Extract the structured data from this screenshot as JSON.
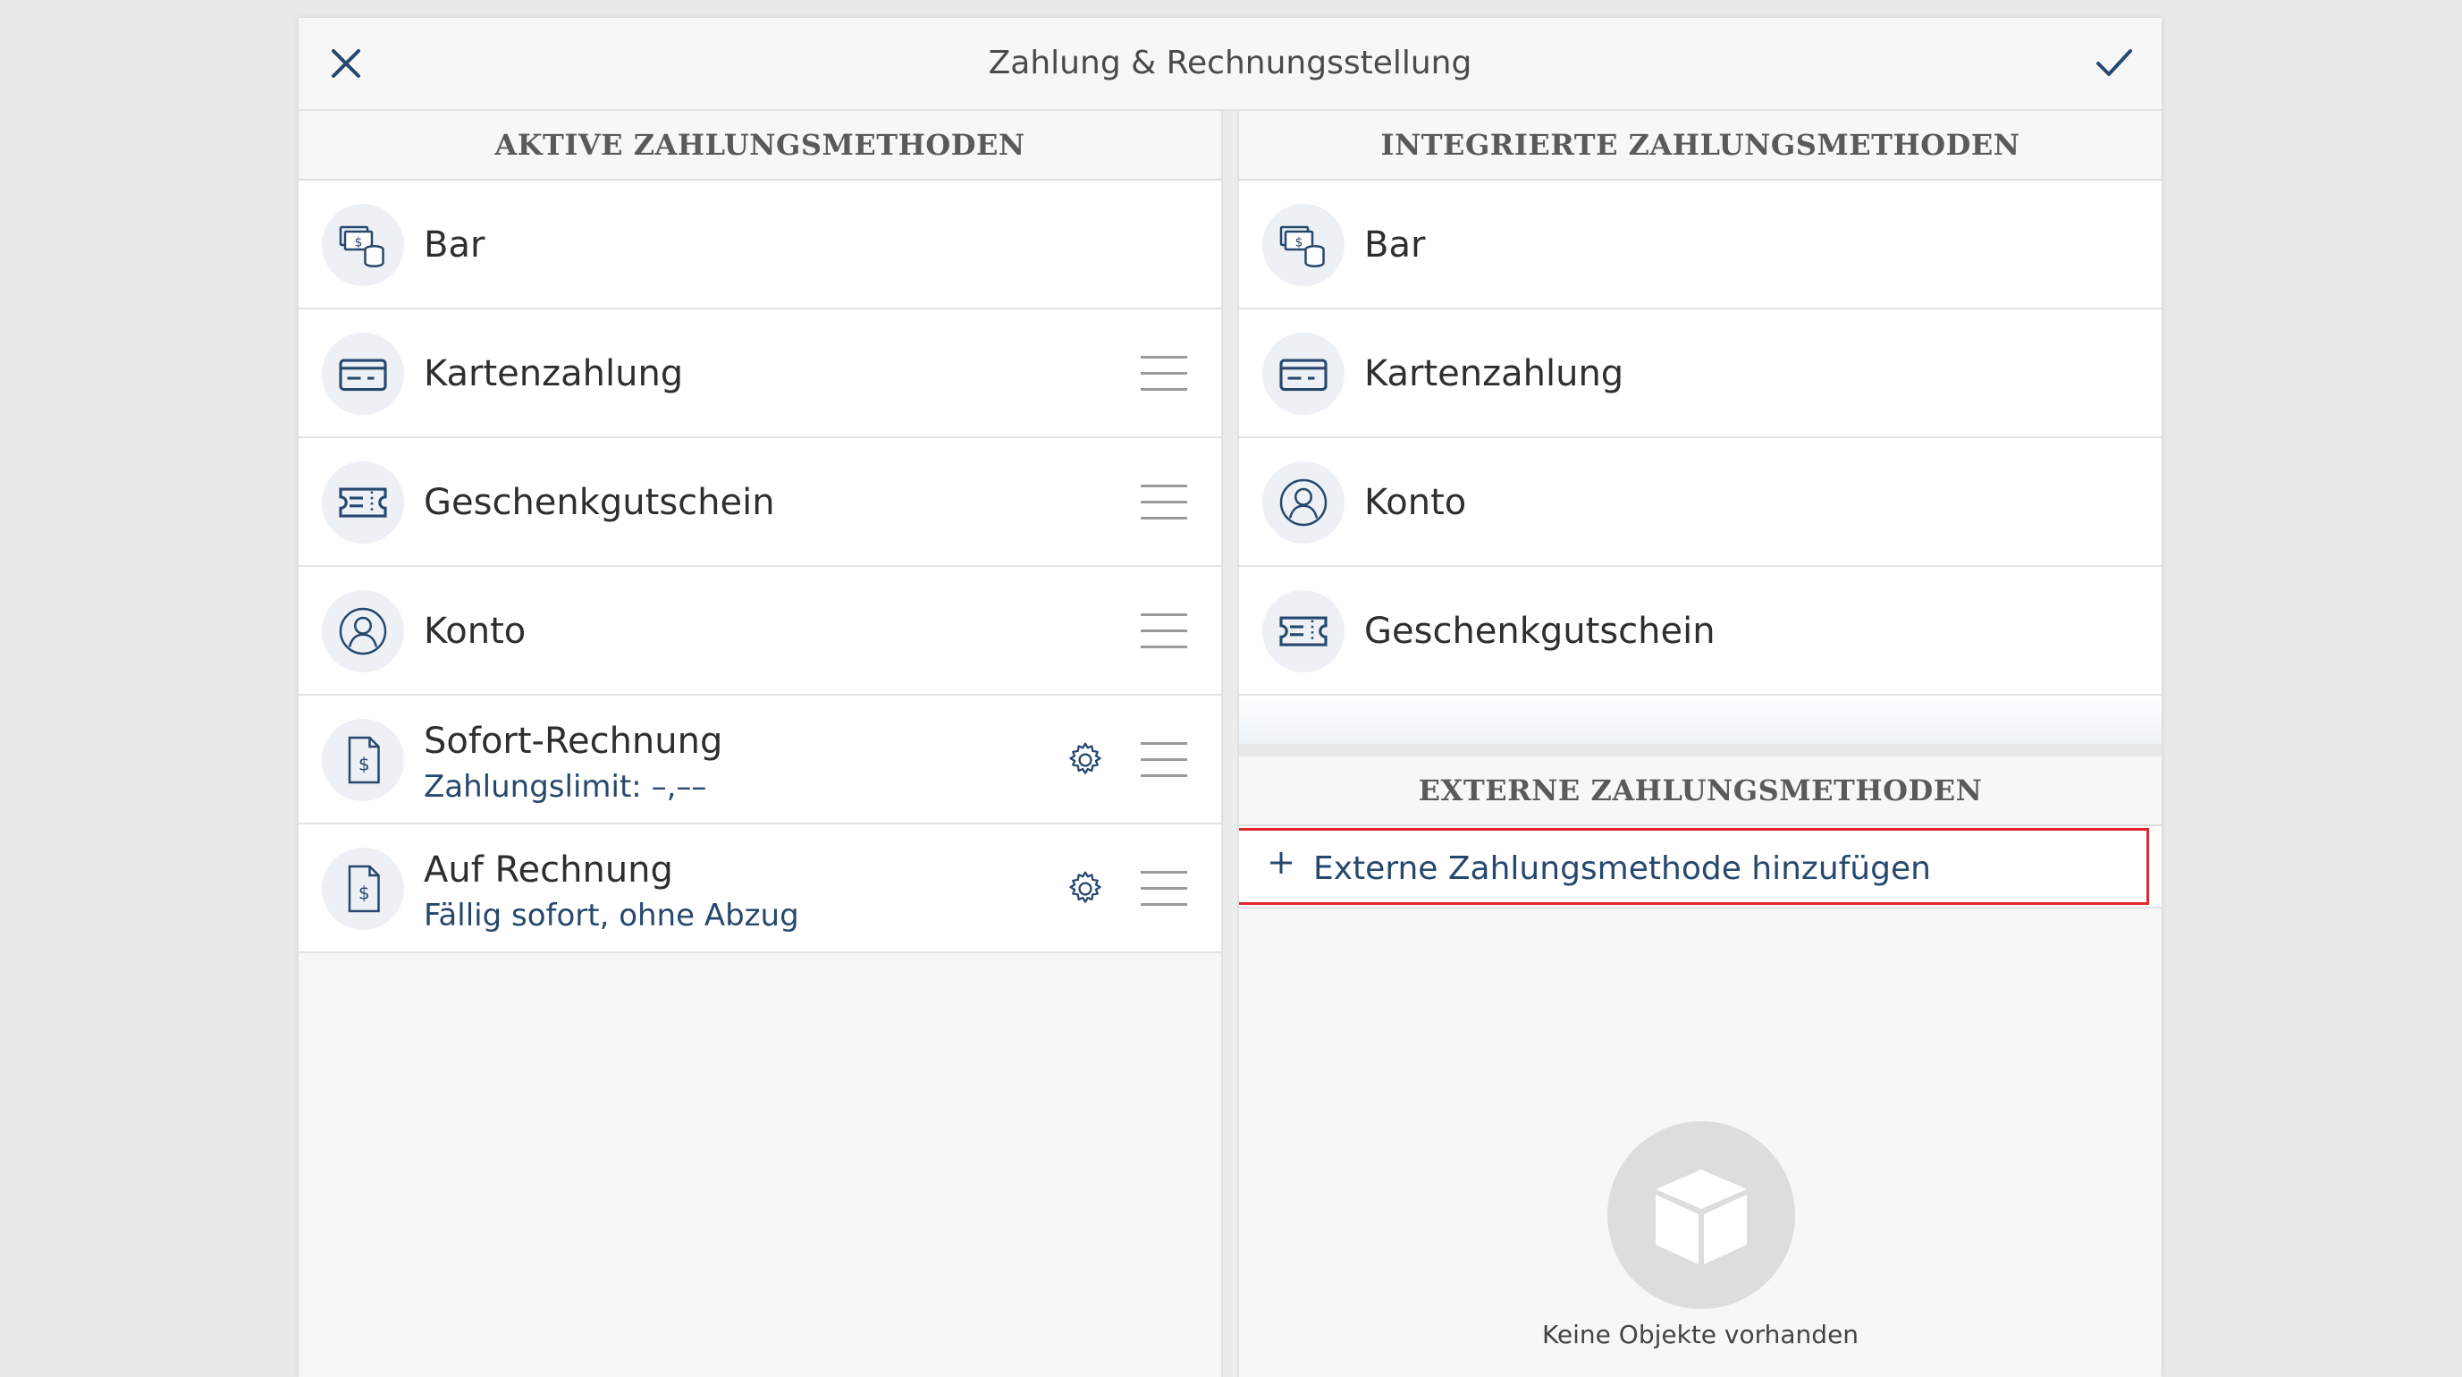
{
  "header": {
    "title": "Zahlung & Rechnungsstellung",
    "close_icon": "close-icon",
    "confirm_icon": "checkmark-icon"
  },
  "active": {
    "heading": "AKTIVE ZAHLUNGSMETHODEN",
    "items": [
      {
        "label": "Bar",
        "icon": "cash-icon"
      },
      {
        "label": "Kartenzahlung",
        "icon": "credit-card-icon"
      },
      {
        "label": "Geschenkgutschein",
        "icon": "gift-voucher-icon"
      },
      {
        "label": "Konto",
        "icon": "user-account-icon"
      },
      {
        "label": "Sofort-Rechnung",
        "sublabel": "Zahlungslimit: –,––",
        "icon": "invoice-icon"
      },
      {
        "label": "Auf Rechnung",
        "sublabel": "Fällig sofort, ohne Abzug",
        "icon": "invoice-icon"
      }
    ]
  },
  "integrated": {
    "heading": "INTEGRIERTE ZAHLUNGSMETHODEN",
    "items": [
      {
        "label": "Bar",
        "icon": "cash-icon"
      },
      {
        "label": "Kartenzahlung",
        "icon": "credit-card-icon"
      },
      {
        "label": "Konto",
        "icon": "user-account-icon"
      },
      {
        "label": "Geschenkgutschein",
        "icon": "gift-voucher-icon"
      }
    ]
  },
  "external": {
    "heading": "EXTERNE ZAHLUNGSMETHODEN",
    "add_label": "Externe Zahlungsmethode hinzufügen",
    "empty_text": "Keine Objekte vorhanden",
    "empty_icon": "box-icon"
  },
  "colors": {
    "accent": "#27486e",
    "highlight": "#e0282c"
  }
}
